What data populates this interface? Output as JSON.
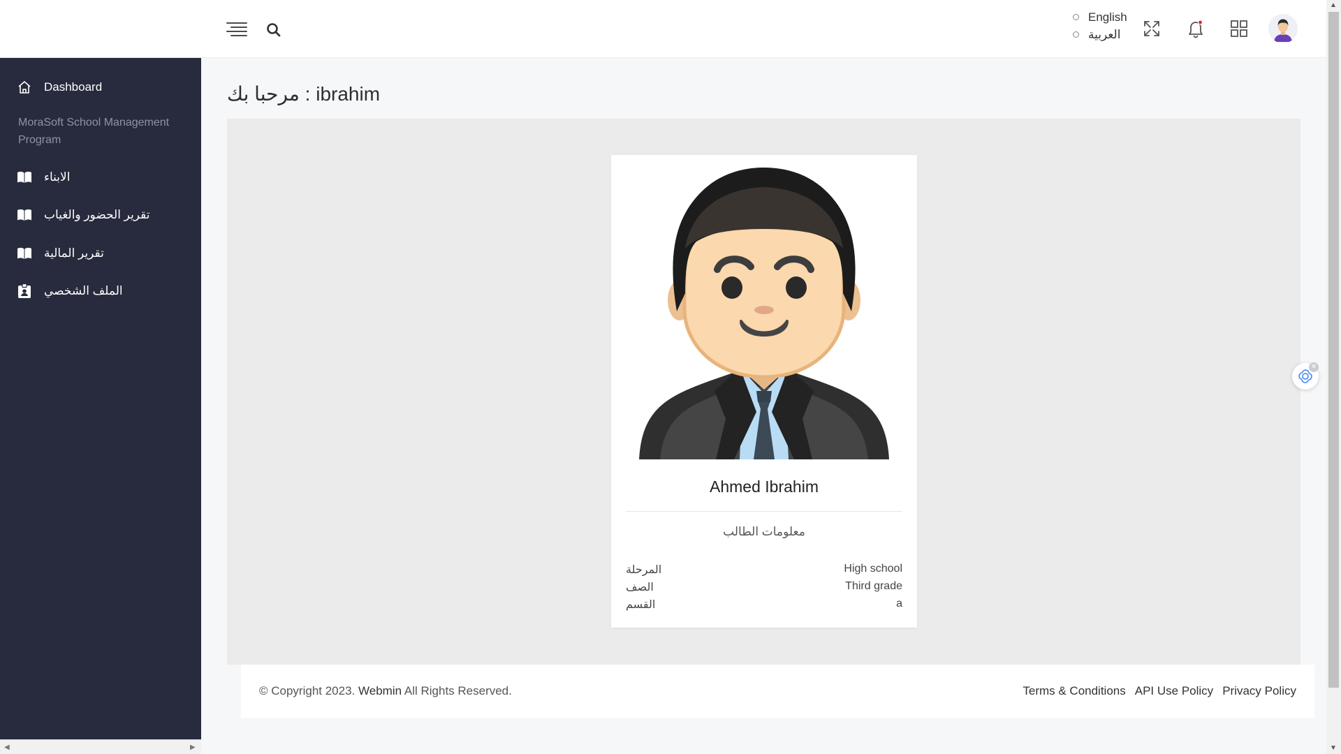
{
  "header": {
    "languages": [
      "English",
      "العربية"
    ]
  },
  "sidebar": {
    "dashboard_label": "Dashboard",
    "program_title": "MoraSoft School Management Program",
    "items": [
      {
        "label": "الابناء",
        "icon": "book-icon"
      },
      {
        "label": "تقرير الحضور والغياب",
        "icon": "book-icon"
      },
      {
        "label": "تقرير المالية",
        "icon": "book-icon"
      },
      {
        "label": "الملف الشخصي",
        "icon": "id-badge-icon"
      }
    ]
  },
  "main": {
    "page_title": "مرحبا بك : ibrahim"
  },
  "student_card": {
    "name": "Ahmed Ibrahim",
    "info_title": "معلومات الطالب",
    "rows": [
      {
        "label": "المرحلة",
        "value": "High school"
      },
      {
        "label": "الصف",
        "value": "Third grade"
      },
      {
        "label": "القسم",
        "value": "a"
      }
    ]
  },
  "footer": {
    "copyright_prefix": "© Copyright 2023.",
    "brand": "Webmin",
    "copyright_suffix": "All Rights Reserved.",
    "links": [
      "Terms & Conditions",
      "API Use Policy",
      "Privacy Policy"
    ]
  },
  "colors": {
    "sidebar_bg": "#272b3d",
    "notification_dot": "#e0242f"
  }
}
